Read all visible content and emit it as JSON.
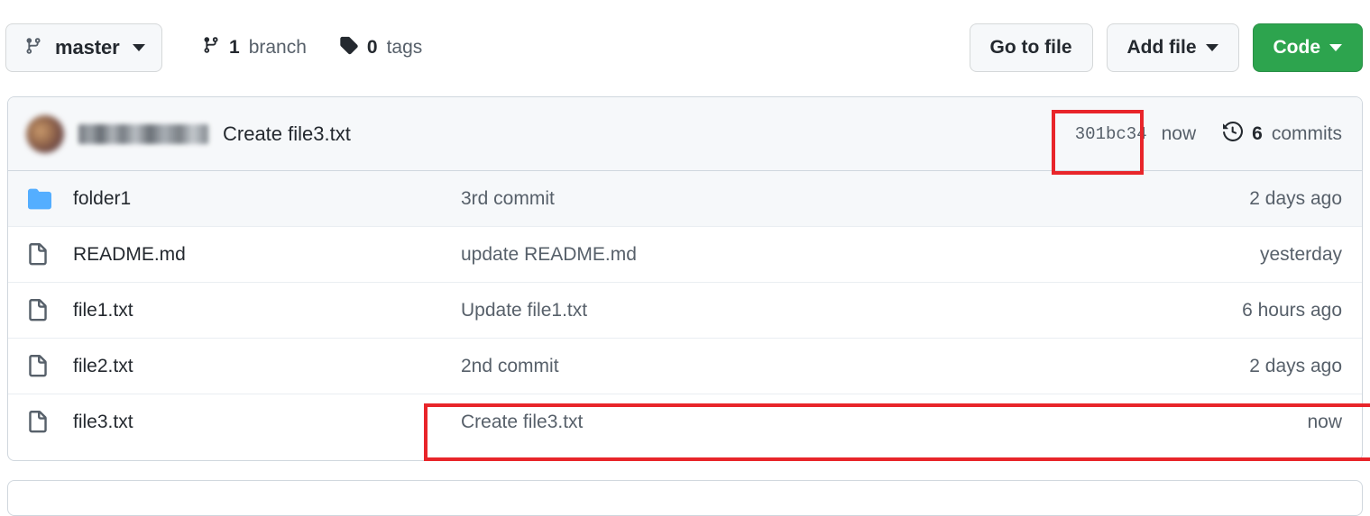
{
  "toolbar": {
    "branch_button": {
      "label": "master",
      "icon": "git-branch-icon",
      "caret": "chevron-down-icon"
    },
    "branch_count": {
      "num": "1",
      "label": "branch",
      "icon": "git-branch-icon"
    },
    "tag_count": {
      "num": "0",
      "label": "tags",
      "icon": "tag-icon"
    },
    "go_to_file": "Go to file",
    "add_file": "Add file",
    "code": "Code"
  },
  "commit_header": {
    "author": "",
    "message": "Create file3.txt",
    "sha": "301bc34",
    "relative_time": "now",
    "commits_num": "6",
    "commits_label": "commits",
    "history_icon": "history-clock-icon"
  },
  "files": [
    {
      "icon": "folder-icon",
      "type": "folder",
      "name": "folder1",
      "message": "3rd commit",
      "age": "2 days ago"
    },
    {
      "icon": "file-icon",
      "type": "file",
      "name": "README.md",
      "message": "update README.md",
      "age": "yesterday"
    },
    {
      "icon": "file-icon",
      "type": "file",
      "name": "file1.txt",
      "message": "Update file1.txt",
      "age": "6 hours ago"
    },
    {
      "icon": "file-icon",
      "type": "file",
      "name": "file2.txt",
      "message": "2nd commit",
      "age": "2 days ago"
    },
    {
      "icon": "file-icon",
      "type": "file",
      "name": "file3.txt",
      "message": "Create file3.txt",
      "age": "now"
    }
  ],
  "annotations": {
    "sha_highlight_color": "#e8252a",
    "row_highlight_color": "#e8252a"
  },
  "colors": {
    "primary_green": "#2da44e",
    "folder_blue": "#54aeff",
    "muted_text": "#57606a",
    "border": "#d0d7de",
    "surface": "#f6f8fa"
  }
}
